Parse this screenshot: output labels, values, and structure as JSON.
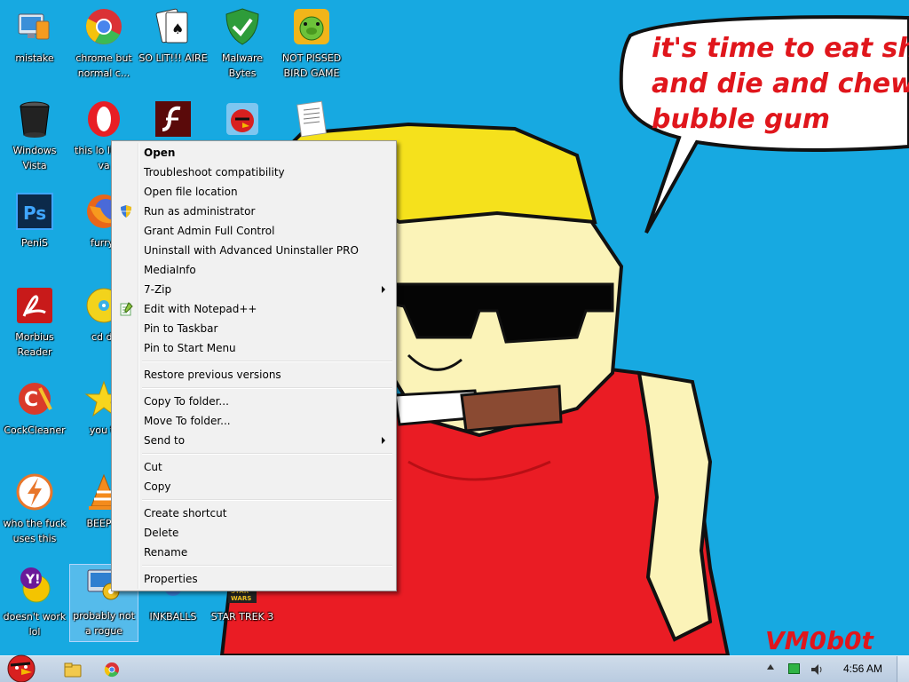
{
  "desktop": {
    "icons": [
      {
        "label": "mistake",
        "icon": "computer-app-icon"
      },
      {
        "label": "chrome but normal c...",
        "icon": "chrome-icon"
      },
      {
        "label": "SO LIT!!! AIRE",
        "icon": "cards-icon"
      },
      {
        "label": "Malware Bytes",
        "icon": "shield-icon"
      },
      {
        "label": "NOT PISSED BIRD GAME",
        "icon": "pig-icon"
      },
      {
        "label": "Windows Vista",
        "icon": "trash-can-icon"
      },
      {
        "label": "this lo like a va",
        "icon": "opera-icon"
      },
      {
        "label": "",
        "icon": "flash-icon"
      },
      {
        "label": "",
        "icon": "angry-bird-icon"
      },
      {
        "label": "",
        "icon": "document-icon"
      },
      {
        "label": "PeniS",
        "icon": "photoshop-icon"
      },
      {
        "label": "furryf",
        "icon": "firefox-icon"
      },
      {
        "label": "Morbius Reader",
        "icon": "pdf-reader-icon"
      },
      {
        "label": "cd dr",
        "icon": "cd-icon"
      },
      {
        "label": "CockCleaner",
        "icon": "ccleaner-icon"
      },
      {
        "label": "you tr",
        "icon": "star-icon"
      },
      {
        "label": "who the fuck uses this",
        "icon": "avast-icon"
      },
      {
        "label": "BEEP B",
        "icon": "vlc-icon"
      },
      {
        "label": "doesn't work lol",
        "icon": "yahoo-icon"
      },
      {
        "label": "probably not a rogue",
        "icon": "settings-app-icon"
      },
      {
        "label": "INKBALLS",
        "icon": "inkballs-icon"
      },
      {
        "label": "STAR TREK 3",
        "icon": "star-wars-icon"
      }
    ],
    "wallpaper": {
      "speech": [
        "it's time to eat shit",
        "and die and chew",
        "bubble gum"
      ],
      "signature": "VM0b0t"
    }
  },
  "context_menu": {
    "items": [
      {
        "label": "Open",
        "bold": true
      },
      {
        "label": "Troubleshoot compatibility"
      },
      {
        "label": "Open file location"
      },
      {
        "label": "Run as administrator",
        "icon": "uac-shield-icon"
      },
      {
        "label": "Grant Admin Full Control"
      },
      {
        "label": "Uninstall with Advanced Uninstaller PRO"
      },
      {
        "label": "MediaInfo"
      },
      {
        "label": "7-Zip",
        "submenu": true
      },
      {
        "label": "Edit with Notepad++",
        "icon": "notepad-plus-icon"
      },
      {
        "label": "Pin to Taskbar"
      },
      {
        "label": "Pin to Start Menu"
      },
      {
        "separator": true
      },
      {
        "label": "Restore previous versions"
      },
      {
        "separator": true
      },
      {
        "label": "Copy To folder..."
      },
      {
        "label": "Move To folder..."
      },
      {
        "label": "Send to",
        "submenu": true
      },
      {
        "separator": true
      },
      {
        "label": "Cut"
      },
      {
        "label": "Copy"
      },
      {
        "separator": true
      },
      {
        "label": "Create shortcut"
      },
      {
        "label": "Delete"
      },
      {
        "label": "Rename"
      },
      {
        "separator": true
      },
      {
        "label": "Properties"
      }
    ]
  },
  "taskbar": {
    "start_icon": "angry-bird-start-icon",
    "pinned": [
      "explorer-icon",
      "chrome-icon"
    ],
    "tray": [
      "show-hidden-icons-icon",
      "network-icon",
      "volume-icon"
    ],
    "clock": "4:56 AM"
  },
  "colors": {
    "desktop_bg": "#17a9e1",
    "speech_text": "#e0161c",
    "menu_bg": "#f1f1f1"
  }
}
